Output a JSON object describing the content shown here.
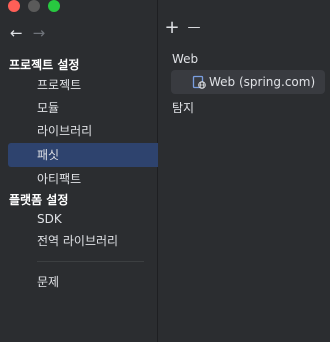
{
  "window": {
    "traffic_lights": {
      "close": "#ff5f57",
      "minimize": "#febc2e",
      "zoom": "#28c840"
    }
  },
  "nav": {
    "back_icon": "arrow-left-icon",
    "forward_icon": "arrow-right-icon",
    "back": "←",
    "forward": "→"
  },
  "sidebar": {
    "project_settings": "프로젝트 설정",
    "items": [
      "프로젝트",
      "모듈",
      "라이브러리",
      "패싯",
      "아티팩트"
    ],
    "platform_settings": "플랫폼 설정",
    "platform_items": [
      "SDK",
      "전역 라이브러리"
    ],
    "problems": "문제"
  },
  "toolbar": {
    "add": "+",
    "remove": "—"
  },
  "facets": {
    "group_label": "Web",
    "selected_item": "Web (spring.com)",
    "detection_label": "탐지"
  },
  "colors": {
    "selection": "#2e436e",
    "background": "#2b2d30",
    "row_highlight": "#393b40"
  }
}
